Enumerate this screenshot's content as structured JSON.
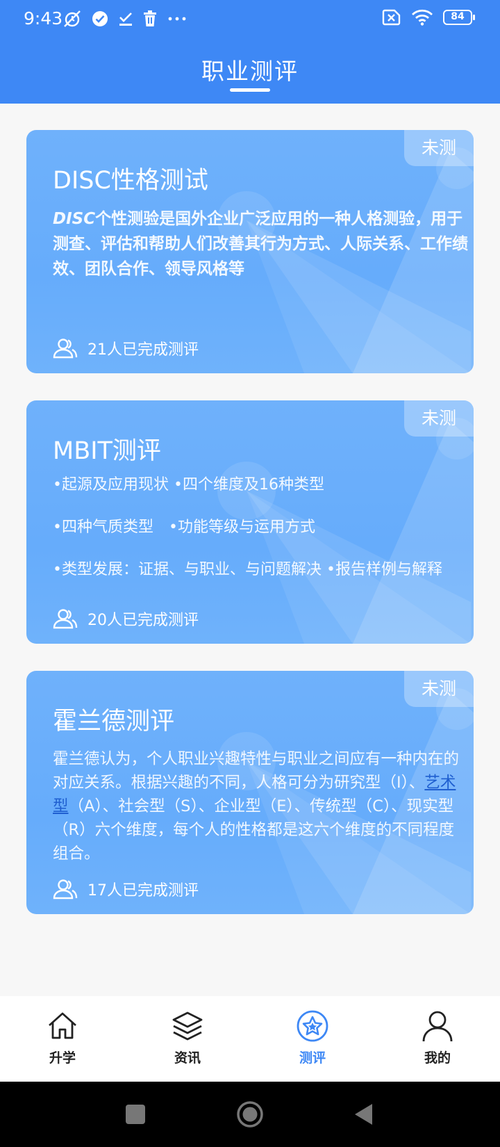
{
  "status_bar": {
    "time": "9:43",
    "battery": "84",
    "icons": [
      "muted-alarm-icon",
      "check-circle-icon",
      "download-done-icon",
      "trash-icon",
      "more-dots-icon",
      "sim-off-icon",
      "wifi-icon",
      "battery-icon"
    ]
  },
  "header": {
    "title": "职业测评"
  },
  "cards": [
    {
      "badge": "未测",
      "title": "DISC性格测试",
      "desc_prefix": "DISC",
      "desc": "个性测验是国外企业广泛应用的一种人格测验，用于测查、评估和帮助人们改善其行为方式、人际关系、工作绩效、团队合作、领导风格等",
      "count": "21人已完成测评"
    },
    {
      "badge": "未测",
      "title": "MBIT测评",
      "bullets": [
        "•起源及应用现状 •四个维度及16种类型",
        "•四种气质类型　•功能等级与运用方式",
        "•类型发展：证据、与职业、与问题解决 •报告样例与解释"
      ],
      "count": "20人已完成测评"
    },
    {
      "badge": "未测",
      "title": "霍兰德测评",
      "desc_part1": "霍兰德认为，个人职业兴趣特性与职业之间应有一种内在的对应关系。根据兴趣的不同，人格可分为研究型（I）、",
      "desc_link": "艺术型",
      "desc_part2": "（A）、社会型（S）、企业型（E）、传统型（C）、现实型（R）六个维度，每个人的性格都是这六个维度的不同程度组合。",
      "count": "17人已完成测评"
    }
  ],
  "tabbar": {
    "tabs": [
      {
        "label": "升学",
        "icon": "home-icon"
      },
      {
        "label": "资讯",
        "icon": "layers-icon"
      },
      {
        "label": "测评",
        "icon": "star-circle-icon",
        "active": true
      },
      {
        "label": "我的",
        "icon": "user-icon"
      }
    ]
  },
  "colors": {
    "primary": "#3e88f5",
    "card": "#6aaefb"
  },
  "system_nav": [
    "recents-square-icon",
    "home-circle-icon",
    "back-triangle-icon"
  ]
}
